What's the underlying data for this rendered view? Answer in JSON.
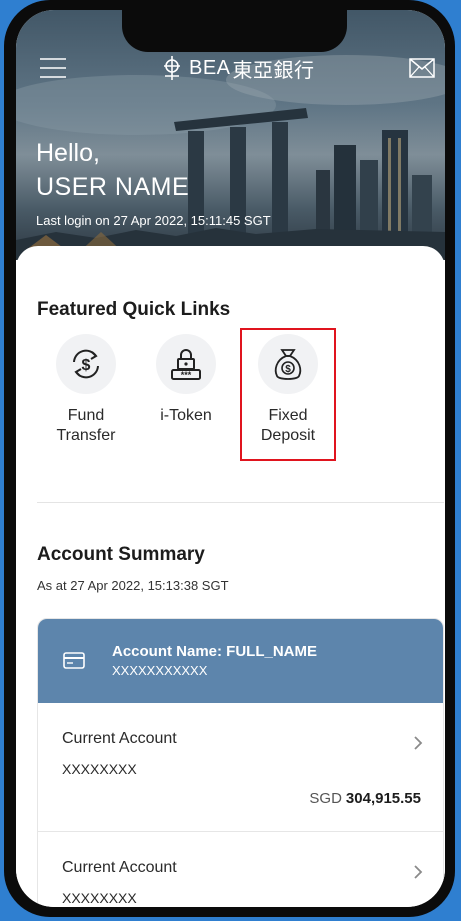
{
  "header": {
    "brand": "BEA",
    "brand_cjk": "東亞銀行"
  },
  "greeting": {
    "hello": "Hello,",
    "user": "USER NAME",
    "last_login": "Last login on 27 Apr 2022, 15:11:45 SGT"
  },
  "quick_links": {
    "title": "Featured Quick Links",
    "items": [
      {
        "line1": "Fund",
        "line2": "Transfer",
        "icon": "fund-transfer-icon"
      },
      {
        "line1": "i-Token",
        "line2": "",
        "icon": "itoken-icon"
      },
      {
        "line1": "Fixed",
        "line2": "Deposit",
        "icon": "money-bag-icon"
      }
    ]
  },
  "summary": {
    "title": "Account Summary",
    "as_at": "As at 27 Apr 2022, 15:13:38 SGT",
    "account_name": "Account Name: FULL_NAME",
    "account_number": "XXXXXXXXXXX",
    "accounts": [
      {
        "type": "Current Account",
        "number": "XXXXXXXX",
        "currency": "SGD",
        "balance": "304,915.55"
      },
      {
        "type": "Current Account",
        "number": "XXXXXXXX",
        "currency": "",
        "balance": ""
      }
    ]
  },
  "colors": {
    "accent": "#5d85ac",
    "highlight": "#e0141e",
    "background": "#2f7fd0"
  }
}
